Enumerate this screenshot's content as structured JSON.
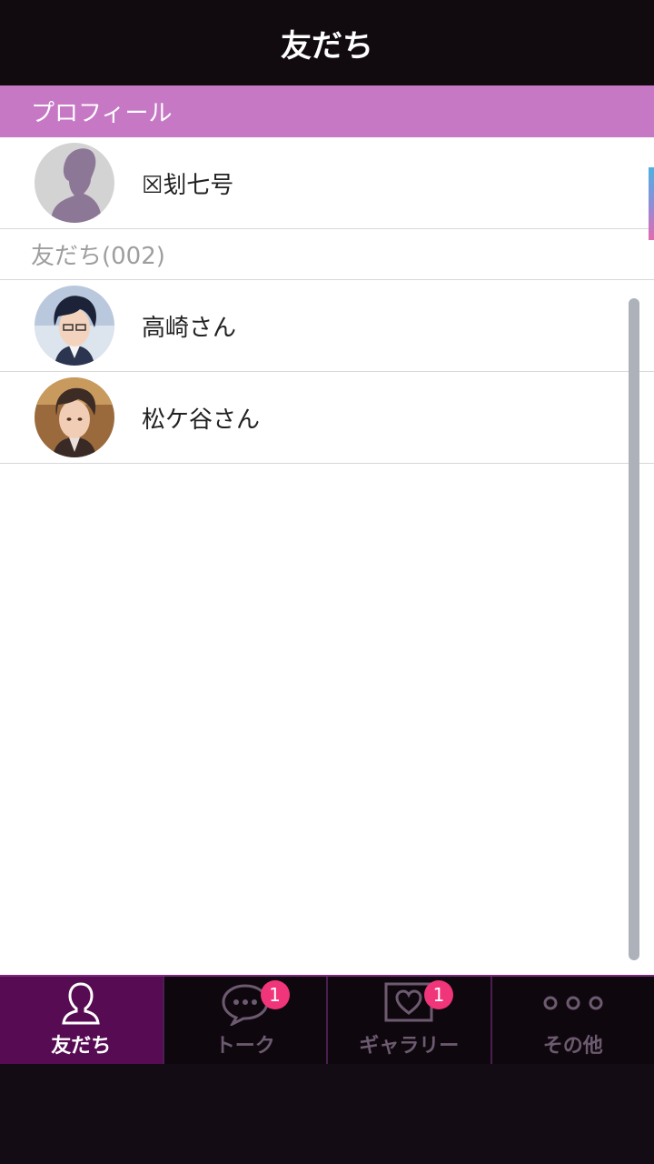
{
  "header": {
    "title": "友だち"
  },
  "profile": {
    "section_label": "プロフィール",
    "user_name": "☒刬七号"
  },
  "friends": {
    "section_label": "友だち(002)",
    "items": [
      {
        "name": "高崎さん"
      },
      {
        "name": "松ケ谷さん"
      }
    ]
  },
  "tabs": [
    {
      "label": "友だち",
      "icon": "person-icon",
      "badge": "",
      "active": true
    },
    {
      "label": "トーク",
      "icon": "chat-bubble-icon",
      "badge": "1",
      "active": false
    },
    {
      "label": "ギャラリー",
      "icon": "heart-frame-icon",
      "badge": "1",
      "active": false
    },
    {
      "label": "その他",
      "icon": "more-dots-icon",
      "badge": "",
      "active": false
    }
  ],
  "colors": {
    "accent": "#c678c4",
    "active_tab": "#560b52",
    "badge": "#f0357a",
    "header_bg": "#110b10"
  }
}
